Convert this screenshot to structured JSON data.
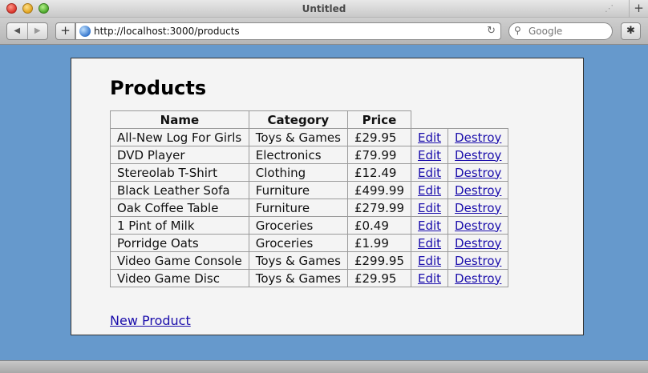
{
  "window": {
    "title": "Untitled"
  },
  "toolbar": {
    "back_icon": "back-arrow-icon",
    "forward_icon": "forward-arrow-icon",
    "add_icon": "plus-icon",
    "url": "http://localhost:3000/products",
    "search_placeholder": "Google",
    "bug_icon": "bug-icon"
  },
  "page": {
    "title": "Products",
    "columns": [
      "Name",
      "Category",
      "Price"
    ],
    "rows": [
      {
        "name": "All-New Log For Girls",
        "category": "Toys & Games",
        "price": "£29.95",
        "edit": "Edit",
        "destroy": "Destroy"
      },
      {
        "name": "DVD Player",
        "category": "Electronics",
        "price": "£79.99",
        "edit": "Edit",
        "destroy": "Destroy"
      },
      {
        "name": "Stereolab T-Shirt",
        "category": "Clothing",
        "price": "£12.49",
        "edit": "Edit",
        "destroy": "Destroy"
      },
      {
        "name": "Black Leather Sofa",
        "category": "Furniture",
        "price": "£499.99",
        "edit": "Edit",
        "destroy": "Destroy"
      },
      {
        "name": "Oak Coffee Table",
        "category": "Furniture",
        "price": "£279.99",
        "edit": "Edit",
        "destroy": "Destroy"
      },
      {
        "name": "1 Pint of Milk",
        "category": "Groceries",
        "price": "£0.49",
        "edit": "Edit",
        "destroy": "Destroy"
      },
      {
        "name": "Porridge Oats",
        "category": "Groceries",
        "price": "£1.99",
        "edit": "Edit",
        "destroy": "Destroy"
      },
      {
        "name": "Video Game Console",
        "category": "Toys & Games",
        "price": "£299.95",
        "edit": "Edit",
        "destroy": "Destroy"
      },
      {
        "name": "Video Game Disc",
        "category": "Toys & Games",
        "price": "£29.95",
        "edit": "Edit",
        "destroy": "Destroy"
      }
    ],
    "new_link": "New Product"
  },
  "colors": {
    "background": "#6699cc",
    "link": "#1a0dab",
    "content_bg": "#f4f4f4"
  }
}
